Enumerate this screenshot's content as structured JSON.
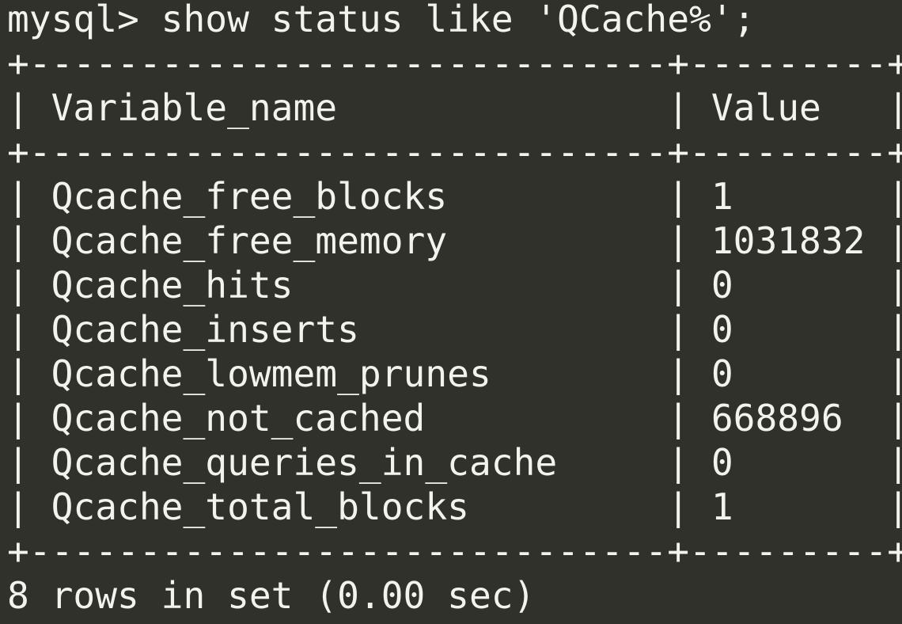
{
  "terminal": {
    "command": "mysql> show status like 'QCache%';",
    "border": "+-----------------------------+---------+",
    "header_row": "| Variable_name               | Value   |",
    "rows": [
      "| Qcache_free_blocks          | 1       |",
      "| Qcache_free_memory          | 1031832 |",
      "| Qcache_hits                 | 0       |",
      "| Qcache_inserts              | 0       |",
      "| Qcache_lowmem_prunes        | 0       |",
      "| Qcache_not_cached           | 668896  |",
      "| Qcache_queries_in_cache     | 0       |",
      "| Qcache_total_blocks         | 1       |"
    ],
    "result": "8 rows in set (0.00 sec)"
  },
  "table": {
    "columns": [
      "Variable_name",
      "Value"
    ],
    "rows": [
      [
        "Qcache_free_blocks",
        "1"
      ],
      [
        "Qcache_free_memory",
        "1031832"
      ],
      [
        "Qcache_hits",
        "0"
      ],
      [
        "Qcache_inserts",
        "0"
      ],
      [
        "Qcache_lowmem_prunes",
        "0"
      ],
      [
        "Qcache_not_cached",
        "668896"
      ],
      [
        "Qcache_queries_in_cache",
        "0"
      ],
      [
        "Qcache_total_blocks",
        "1"
      ]
    ]
  },
  "colors": {
    "background": "#31312c",
    "foreground": "#f2f2ee"
  }
}
